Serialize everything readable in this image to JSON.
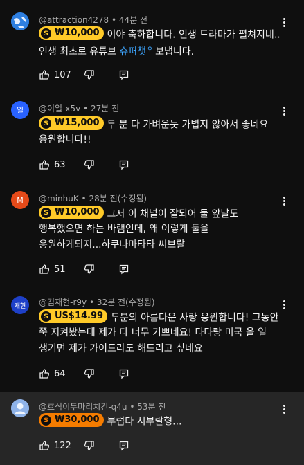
{
  "comments": [
    {
      "author": "@attraction4278",
      "time": "44분 전",
      "avatar_color": "#2e7fe0",
      "avatar_text": "",
      "chip": {
        "amount": "₩10,000",
        "color": "#ffca28"
      },
      "line1": "이야 축하합니다. 인생 드라마가 펼쳐지네..",
      "line2_prefix": "인생 최초로 유튜브 ",
      "line2_link": "슈퍼챗",
      "line2_suffix": " 보냅니다.",
      "likes": "107"
    },
    {
      "author": "@이일-x5v",
      "time": "27분 전",
      "avatar_color": "#2962ff",
      "avatar_text": "일",
      "chip": {
        "amount": "₩15,000",
        "color": "#ffca28"
      },
      "line1": "두 분 다 가벼운듯 가볍지 않아서 좋네요",
      "line2": "응원합니다!!",
      "likes": "63"
    },
    {
      "author": "@minhuK",
      "time": "28분 전(수정됨)",
      "avatar_color": "#e64a19",
      "avatar_text": "M",
      "chip": {
        "amount": "₩10,000",
        "color": "#ffca28"
      },
      "line1": "그저 이 채널이 잘되어 둘 앞날도",
      "line2": "행복했으면 하는 바램인데, 왜 이렇게 둘을",
      "line3": "응원하게되지...하쿠나마타타 씨브랄",
      "likes": "51"
    },
    {
      "author": "@김재현-r9y",
      "time": "32분 전(수정됨)",
      "avatar_color": "#1e40c8",
      "avatar_text": "재현",
      "chip": {
        "amount": "US$14.99",
        "color": "#ffca28"
      },
      "line1": "두분의 아름다운 사랑 응원합니다! 그동안",
      "line2": "쭉 지켜봤는데 제가 다 너무 기쁘네요! 타타랑 미국 올 일",
      "line3": "생기면 제가 가이드라도 해드리고 싶네요",
      "likes": "64"
    },
    {
      "author": "@호식이두마리치킨-q4u",
      "time": "53분 전",
      "avatar_color": "#8fb3e8",
      "avatar_text": "",
      "chip": {
        "amount": "₩30,000",
        "color": "#f57c00"
      },
      "line1": "부럽다 시부랄형...",
      "likes": "122"
    }
  ]
}
